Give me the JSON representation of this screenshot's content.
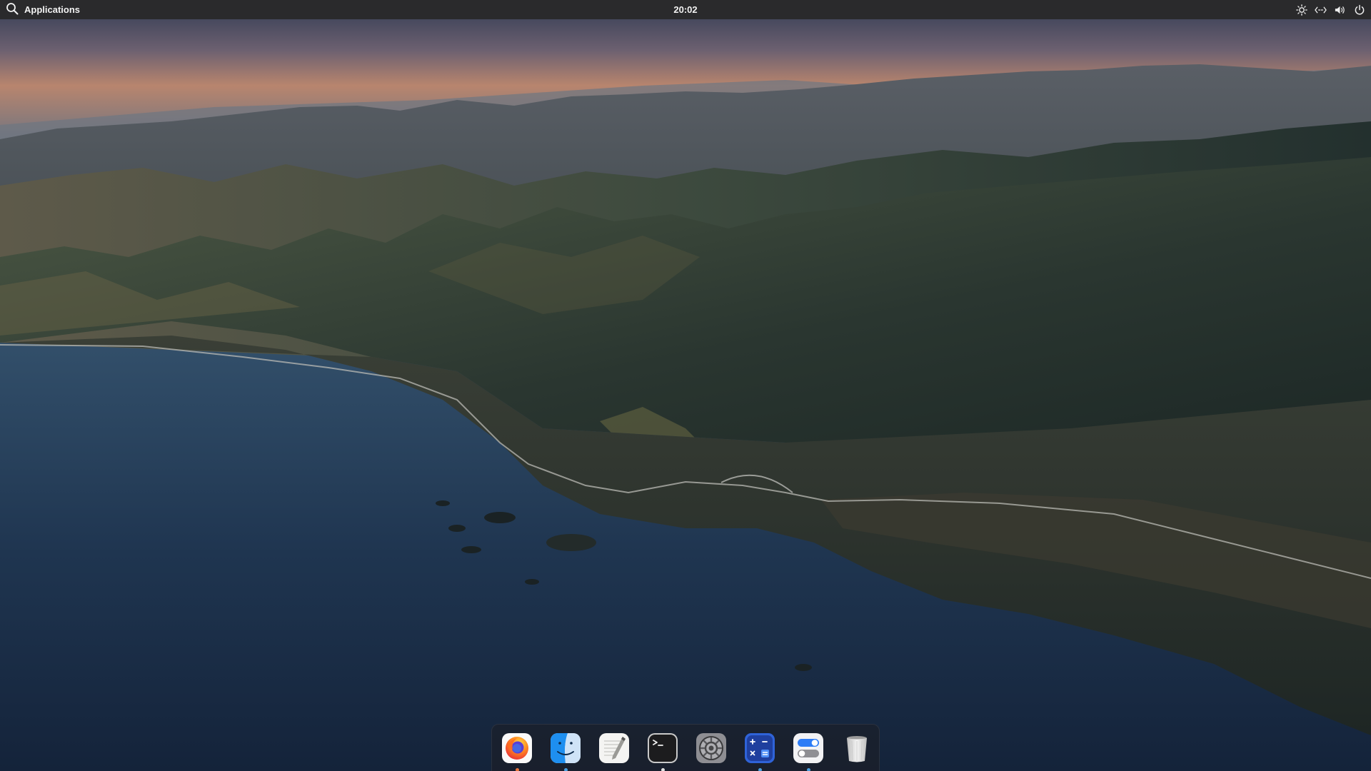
{
  "topbar": {
    "applications_label": "Applications",
    "clock": "20:02",
    "tray": [
      {
        "icon": "brightness-icon"
      },
      {
        "icon": "network-arrows-icon"
      },
      {
        "icon": "volume-icon"
      },
      {
        "icon": "power-icon"
      }
    ]
  },
  "dock": {
    "items": [
      {
        "name": "firefox",
        "icon": "firefox-icon",
        "running": true,
        "indicator_color": "#e8743b"
      },
      {
        "name": "finder",
        "icon": "finder-icon",
        "running": true,
        "indicator_color": "#4a9fe0"
      },
      {
        "name": "text-editor",
        "icon": "text-editor-icon",
        "running": false
      },
      {
        "name": "terminal",
        "icon": "terminal-icon",
        "running": true,
        "indicator_color": "#e0e0e0"
      },
      {
        "name": "system-settings",
        "icon": "settings-gear-icon",
        "running": false
      },
      {
        "name": "calculator",
        "icon": "calculator-icon",
        "running": true,
        "indicator_color": "#4a9fe0"
      },
      {
        "name": "toggles",
        "icon": "toggle-switches-icon",
        "running": true,
        "indicator_color": "#4a9fe0"
      },
      {
        "name": "trash",
        "icon": "trash-icon",
        "running": false
      }
    ]
  },
  "colors": {
    "topbar_bg": "#2a2a2c",
    "sea": "#1c2f44",
    "mountains": "#3c4a40",
    "sky_glow": "#c98a6a"
  },
  "wallpaper": {
    "subject": "coastal-mountains-at-dusk"
  }
}
